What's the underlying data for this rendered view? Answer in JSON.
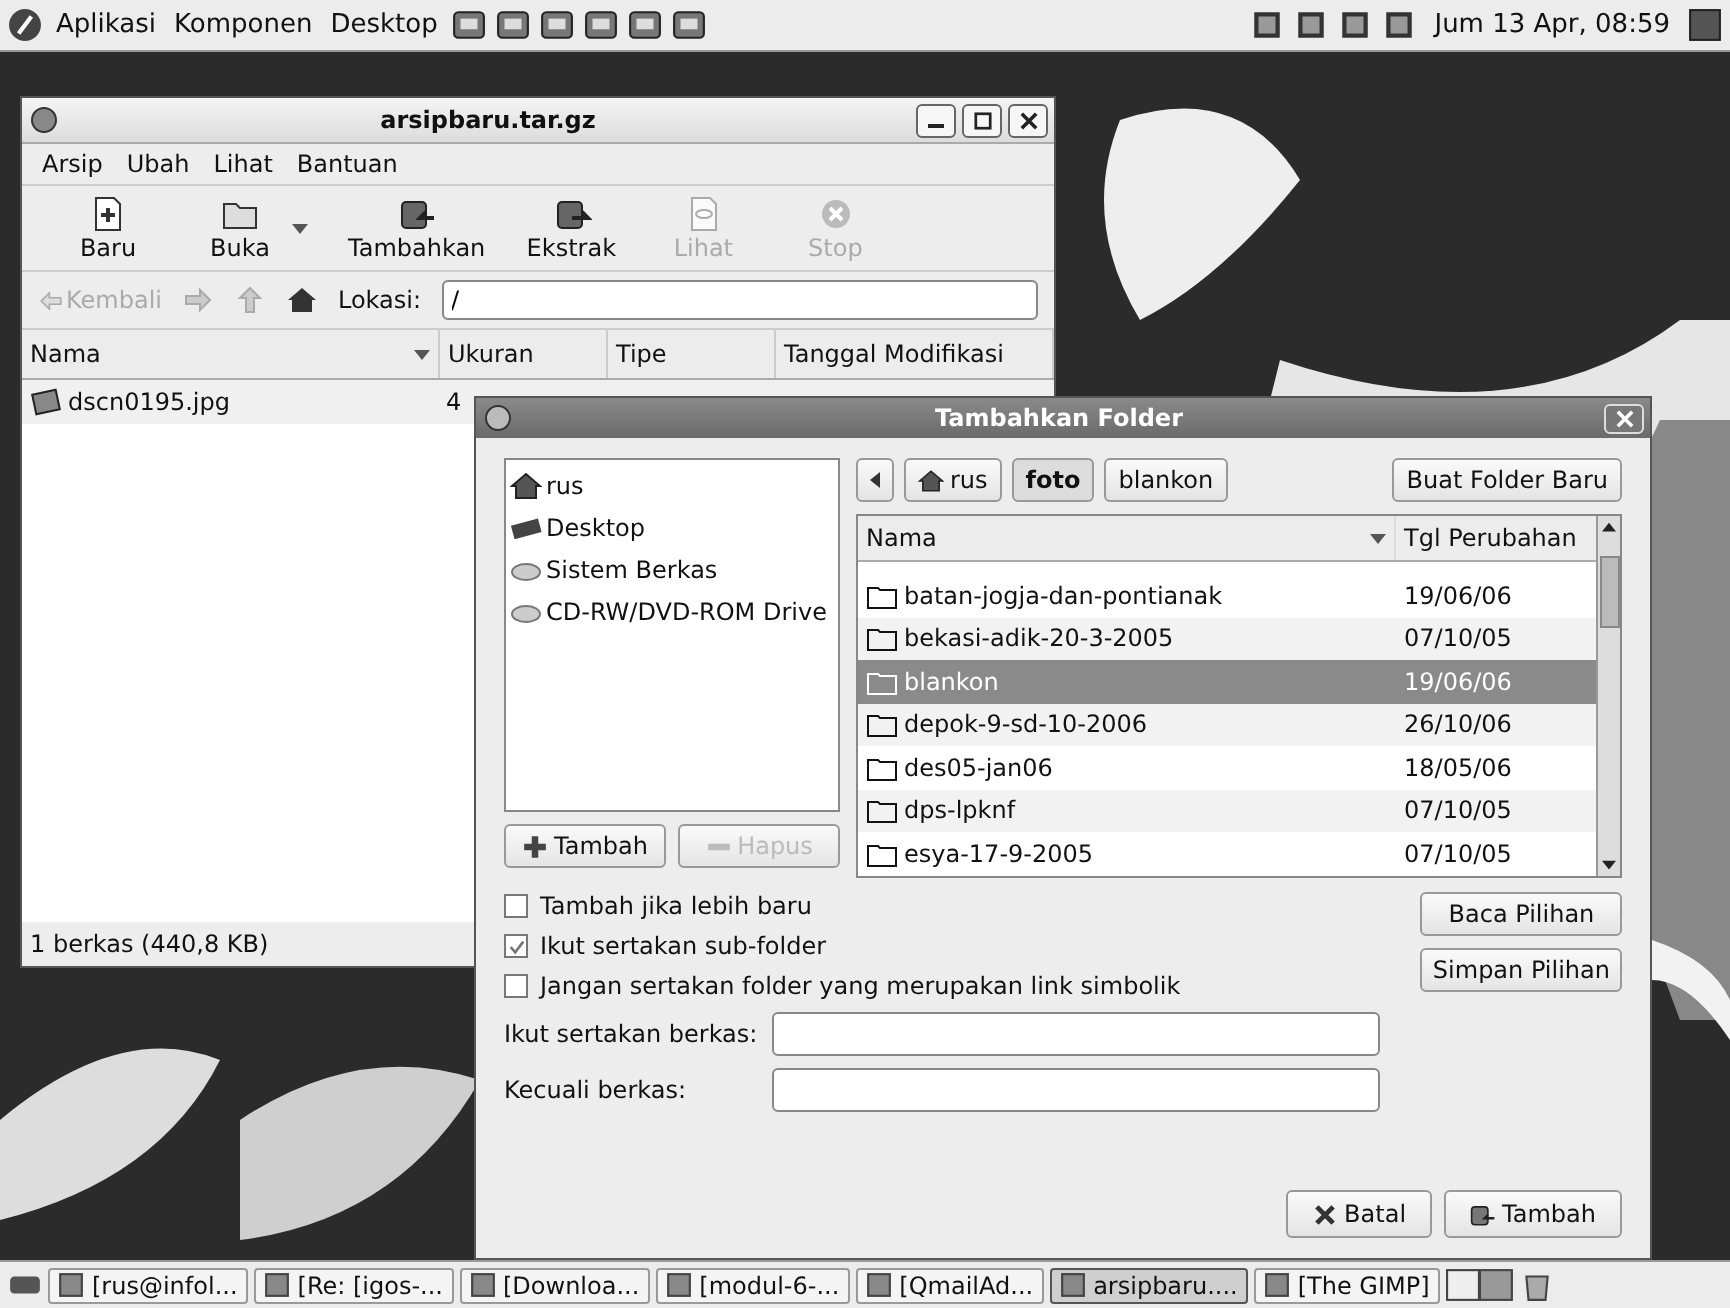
{
  "top_panel": {
    "menus": [
      "Aplikasi",
      "Komponen",
      "Desktop"
    ],
    "clock": "Jum 13 Apr, 08:59"
  },
  "archive_window": {
    "title": "arsipbaru.tar.gz",
    "menu": [
      "Arsip",
      "Ubah",
      "Lihat",
      "Bantuan"
    ],
    "toolbar": [
      {
        "label": "Baru",
        "kind": "new",
        "disabled": false,
        "dropdown": false
      },
      {
        "label": "Buka",
        "kind": "open",
        "disabled": false,
        "dropdown": true
      },
      {
        "label": "Tambahkan",
        "kind": "add",
        "disabled": false,
        "dropdown": false
      },
      {
        "label": "Ekstrak",
        "kind": "extract",
        "disabled": false,
        "dropdown": false
      },
      {
        "label": "Lihat",
        "kind": "view",
        "disabled": true,
        "dropdown": false
      },
      {
        "label": "Stop",
        "kind": "stop",
        "disabled": true,
        "dropdown": false
      }
    ],
    "back": {
      "label": "Kembali",
      "disabled": true
    },
    "location_label": "Lokasi:",
    "location_value": "/",
    "columns": [
      "Nama",
      "Ukuran",
      "Tipe",
      "Tanggal Modifikasi"
    ],
    "rows": [
      {
        "name": "dscn0195.jpg",
        "size": "4"
      }
    ],
    "status": "1 berkas (440,8 KB)"
  },
  "dialog": {
    "title": "Tambahkan Folder",
    "places": [
      {
        "label": "rus",
        "kind": "home"
      },
      {
        "label": "Desktop",
        "kind": "desktop"
      },
      {
        "label": "Sistem Berkas",
        "kind": "drive"
      },
      {
        "label": "CD-RW/DVD-ROM Drive",
        "kind": "drive"
      }
    ],
    "place_buttons": [
      {
        "label": "Tambah",
        "kind": "plus",
        "disabled": false
      },
      {
        "label": "Hapus",
        "kind": "minus",
        "disabled": true
      }
    ],
    "path": [
      {
        "label": "rus",
        "kind": "home",
        "selected": false
      },
      {
        "label": "foto",
        "kind": "folder",
        "selected": true
      },
      {
        "label": "blankon",
        "kind": "folder",
        "selected": false
      }
    ],
    "new_folder": "Buat Folder Baru",
    "columns": [
      "Nama",
      "Tgl Perubahan"
    ],
    "files": [
      {
        "name": "batan-jogja-dan-pontianak",
        "date": "19/06/06",
        "selected": false
      },
      {
        "name": "bekasi-adik-20-3-2005",
        "date": "07/10/05",
        "selected": false
      },
      {
        "name": "blankon",
        "date": "19/06/06",
        "selected": true
      },
      {
        "name": "depok-9-sd-10-2006",
        "date": "26/10/06",
        "selected": false
      },
      {
        "name": "des05-jan06",
        "date": "18/05/06",
        "selected": false
      },
      {
        "name": "dps-lpknf",
        "date": "07/10/05",
        "selected": false
      },
      {
        "name": "esya-17-9-2005",
        "date": "07/10/05",
        "selected": false
      }
    ],
    "options": [
      {
        "label": "Tambah jika lebih baru",
        "checked": false
      },
      {
        "label": "Ikut sertakan sub-folder",
        "checked": true
      },
      {
        "label": "Jangan sertakan folder yang merupakan link simbolik",
        "checked": false
      }
    ],
    "side_buttons": [
      "Baca Pilihan",
      "Simpan Pilihan"
    ],
    "fields": [
      "Ikut sertakan berkas:",
      "Kecuali berkas:"
    ],
    "buttons": [
      {
        "label": "Batal",
        "kind": "cancel"
      },
      {
        "label": "Tambah",
        "kind": "add"
      }
    ]
  },
  "taskbar": [
    {
      "label": "[rus@infol...",
      "selected": false
    },
    {
      "label": "[Re: [igos-...",
      "selected": false
    },
    {
      "label": "[Downloa...",
      "selected": false
    },
    {
      "label": "[modul-6-...",
      "selected": false
    },
    {
      "label": "[QmailAd...",
      "selected": false
    },
    {
      "label": "arsipbaru....",
      "selected": true
    },
    {
      "label": "[The GIMP]",
      "selected": false
    }
  ]
}
